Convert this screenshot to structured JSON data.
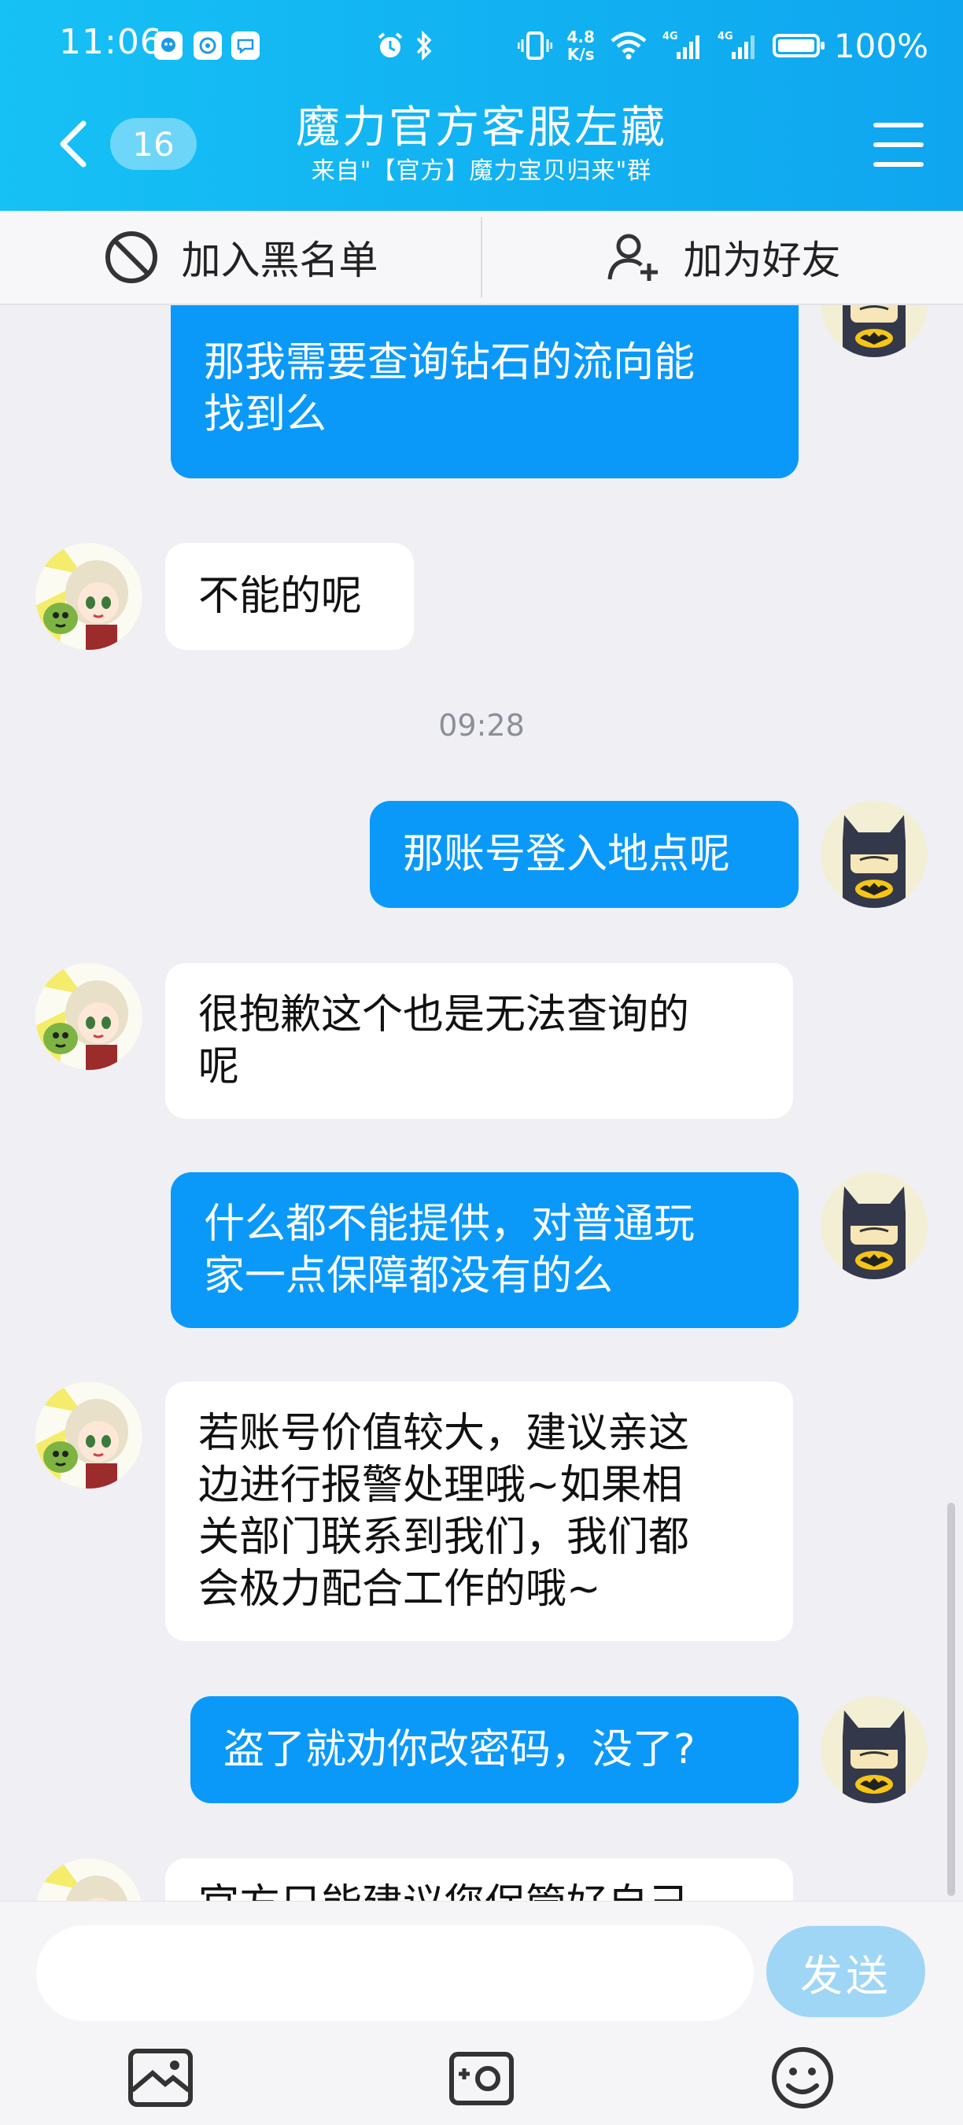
{
  "status_bar": {
    "time": "11:06",
    "network_speed_value": "4.8",
    "network_speed_unit": "K/s",
    "signal1": "4G",
    "signal2": "4G",
    "battery": "100%"
  },
  "header": {
    "unread_count": "16",
    "title": "魔力官方客服左藏",
    "subtitle": "来自\"【官方】魔力宝贝归来\"群"
  },
  "actions": {
    "blacklist": "加入黑名单",
    "add_friend": "加为好友"
  },
  "messages": [
    {
      "from": "me",
      "lines": [
        "那我需要查询钻石的流向能",
        "找到么"
      ]
    },
    {
      "from": "agent",
      "lines": [
        "不能的呢"
      ]
    },
    {
      "type": "time",
      "text": "09:28"
    },
    {
      "from": "me",
      "lines": [
        "那账号登入地点呢"
      ]
    },
    {
      "from": "agent",
      "lines": [
        "很抱歉这个也是无法查询的",
        "呢"
      ]
    },
    {
      "from": "me",
      "lines": [
        "什么都不能提供，对普通玩",
        "家一点保障都没有的么"
      ]
    },
    {
      "from": "agent",
      "lines": [
        "若账号价值较大，建议亲这",
        "边进行报警处理哦~如果相",
        "关部门联系到我们，我们都",
        "会极力配合工作的哦~"
      ]
    },
    {
      "from": "me",
      "lines": [
        "盗了就劝你改密码，没了?"
      ]
    },
    {
      "from": "agent",
      "lines": [
        "官方只能建议您保管好自己"
      ]
    }
  ],
  "input": {
    "placeholder": "",
    "send_label": "发送"
  },
  "colors": {
    "header": "#12b4f2",
    "outgoing_bubble": "#0a99f9",
    "incoming_bubble": "#ffffff",
    "background": "#efeff4",
    "send_button": "#9fd6f6"
  },
  "icons": [
    "back-arrow-icon",
    "menu-icon",
    "block-icon",
    "add-friend-icon",
    "image-icon",
    "camera-icon",
    "emoji-icon"
  ]
}
